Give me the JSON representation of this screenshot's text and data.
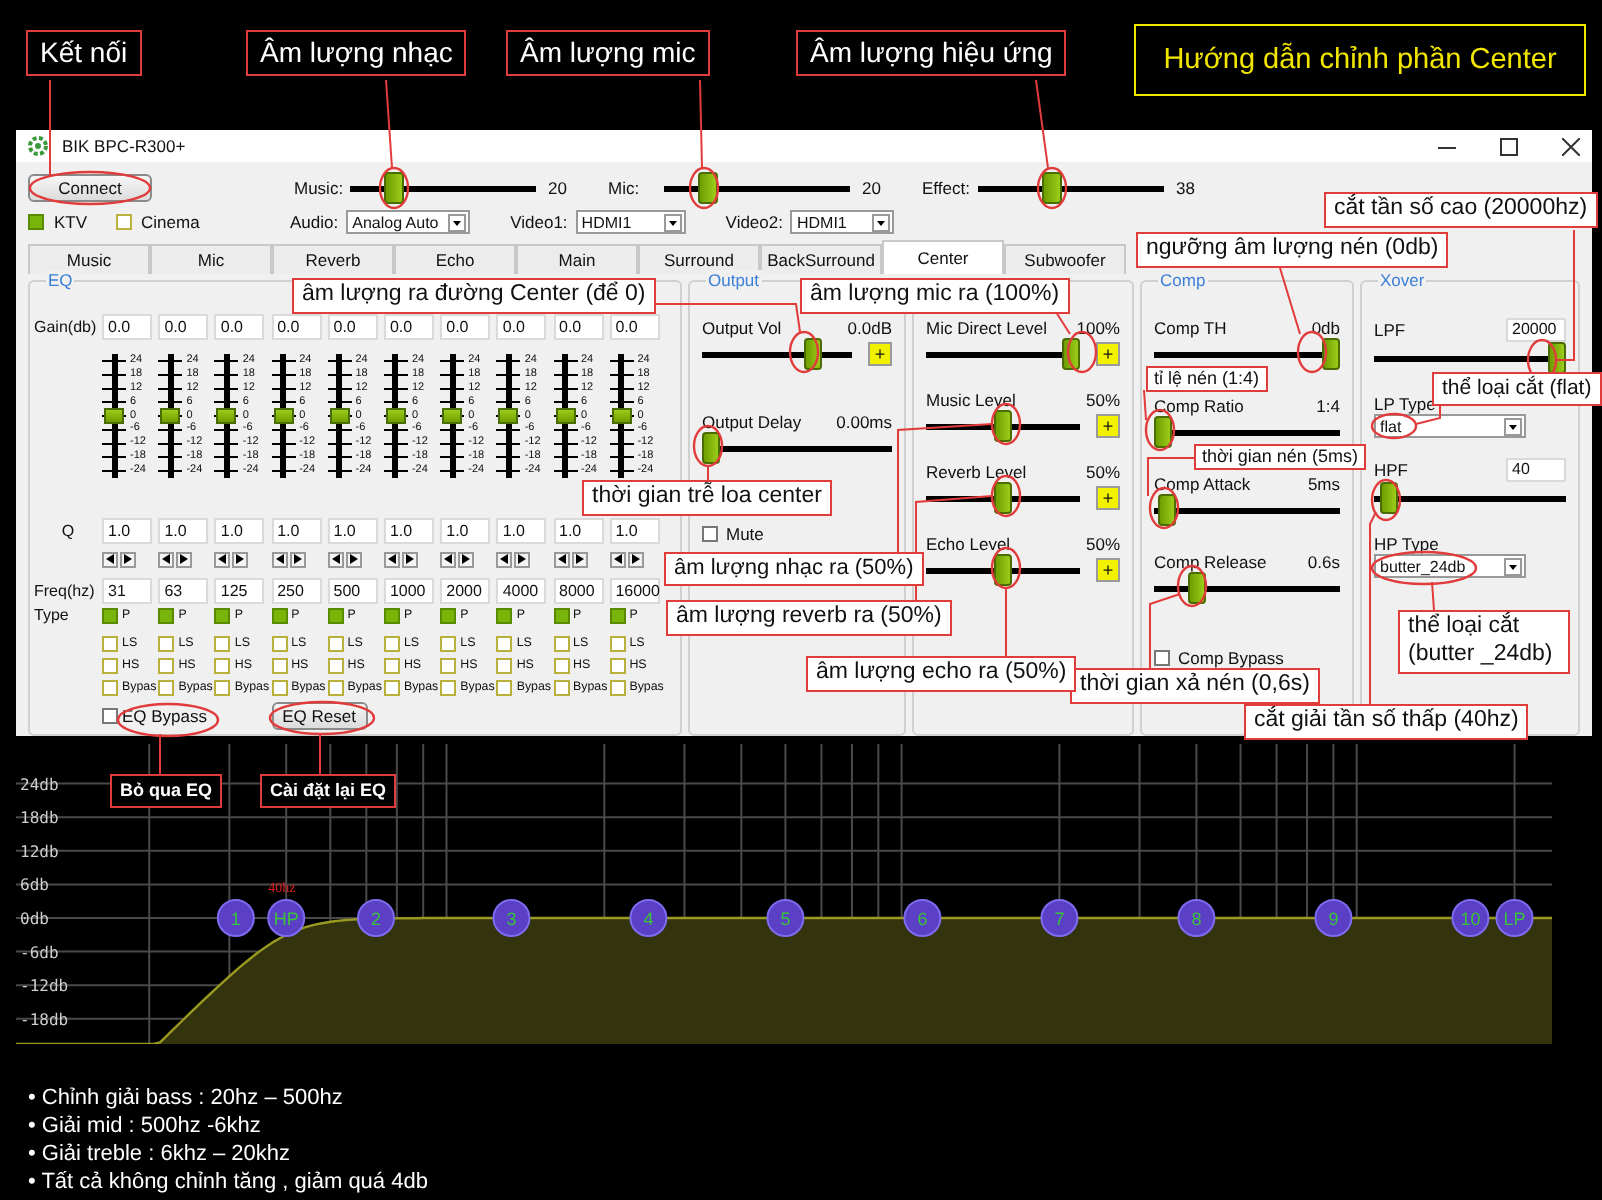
{
  "guide_title": "Hướng dẫn chỉnh phần Center",
  "window": {
    "title": "BIK BPC-R300+"
  },
  "connect_button": "Connect",
  "master_sliders": [
    {
      "label": "Music:",
      "level": 0.2,
      "reading": "20"
    },
    {
      "label": "Mic:",
      "level": 0.2,
      "reading": "20"
    },
    {
      "label": "Effect:",
      "level": 0.38,
      "reading": "38"
    }
  ],
  "mode_checks": [
    {
      "label": "KTV",
      "checked": true
    },
    {
      "label": "Cinema",
      "checked": false
    }
  ],
  "selects": [
    {
      "label": "Audio:",
      "value": "Analog Auto"
    },
    {
      "label": "Video1:",
      "value": "HDMI1"
    },
    {
      "label": "Video2:",
      "value": "HDMI1"
    }
  ],
  "tabs": [
    {
      "label": "Music",
      "selected": false
    },
    {
      "label": "Mic",
      "selected": false
    },
    {
      "label": "Reverb",
      "selected": false
    },
    {
      "label": "Echo",
      "selected": false
    },
    {
      "label": "Main",
      "selected": false
    },
    {
      "label": "Surround",
      "selected": false
    },
    {
      "label": "BackSurround",
      "selected": false
    },
    {
      "label": "Center",
      "selected": true
    },
    {
      "label": "Subwoofer",
      "selected": false
    }
  ],
  "eq": {
    "title": "EQ",
    "gain_label": "Gain(db)",
    "q_label": "Q",
    "freq_label": "Freq(hz)",
    "type_label": "Type",
    "bands": [
      {
        "gain": "0.0",
        "level": 0.5,
        "scale": [
          "24",
          "18",
          "12",
          "6",
          "0",
          "-6",
          "-12",
          "-18",
          "-24"
        ],
        "q": "1.0",
        "freq": "31",
        "types": [
          {
            "label": "P",
            "checked": true
          },
          {
            "label": "LS",
            "checked": false
          },
          {
            "label": "HS",
            "checked": false
          },
          {
            "label": "Bypas",
            "checked": false
          }
        ]
      },
      {
        "gain": "0.0",
        "level": 0.5,
        "scale": [
          "24",
          "18",
          "12",
          "6",
          "0",
          "-6",
          "-12",
          "-18",
          "-24"
        ],
        "q": "1.0",
        "freq": "63",
        "types": [
          {
            "label": "P",
            "checked": true
          },
          {
            "label": "LS",
            "checked": false
          },
          {
            "label": "HS",
            "checked": false
          },
          {
            "label": "Bypas",
            "checked": false
          }
        ]
      },
      {
        "gain": "0.0",
        "level": 0.5,
        "scale": [
          "24",
          "18",
          "12",
          "6",
          "0",
          "-6",
          "-12",
          "-18",
          "-24"
        ],
        "q": "1.0",
        "freq": "125",
        "types": [
          {
            "label": "P",
            "checked": true
          },
          {
            "label": "LS",
            "checked": false
          },
          {
            "label": "HS",
            "checked": false
          },
          {
            "label": "Bypas",
            "checked": false
          }
        ]
      },
      {
        "gain": "0.0",
        "level": 0.5,
        "scale": [
          "24",
          "18",
          "12",
          "6",
          "0",
          "-6",
          "-12",
          "-18",
          "-24"
        ],
        "q": "1.0",
        "freq": "250",
        "types": [
          {
            "label": "P",
            "checked": true
          },
          {
            "label": "LS",
            "checked": false
          },
          {
            "label": "HS",
            "checked": false
          },
          {
            "label": "Bypas",
            "checked": false
          }
        ]
      },
      {
        "gain": "0.0",
        "level": 0.5,
        "scale": [
          "24",
          "18",
          "12",
          "6",
          "0",
          "-6",
          "-12",
          "-18",
          "-24"
        ],
        "q": "1.0",
        "freq": "500",
        "types": [
          {
            "label": "P",
            "checked": true
          },
          {
            "label": "LS",
            "checked": false
          },
          {
            "label": "HS",
            "checked": false
          },
          {
            "label": "Bypas",
            "checked": false
          }
        ]
      },
      {
        "gain": "0.0",
        "level": 0.5,
        "scale": [
          "24",
          "18",
          "12",
          "6",
          "0",
          "-6",
          "-12",
          "-18",
          "-24"
        ],
        "q": "1.0",
        "freq": "1000",
        "types": [
          {
            "label": "P",
            "checked": true
          },
          {
            "label": "LS",
            "checked": false
          },
          {
            "label": "HS",
            "checked": false
          },
          {
            "label": "Bypas",
            "checked": false
          }
        ]
      },
      {
        "gain": "0.0",
        "level": 0.5,
        "scale": [
          "24",
          "18",
          "12",
          "6",
          "0",
          "-6",
          "-12",
          "-18",
          "-24"
        ],
        "q": "1.0",
        "freq": "2000",
        "types": [
          {
            "label": "P",
            "checked": true
          },
          {
            "label": "LS",
            "checked": false
          },
          {
            "label": "HS",
            "checked": false
          },
          {
            "label": "Bypas",
            "checked": false
          }
        ]
      },
      {
        "gain": "0.0",
        "level": 0.5,
        "scale": [
          "24",
          "18",
          "12",
          "6",
          "0",
          "-6",
          "-12",
          "-18",
          "-24"
        ],
        "q": "1.0",
        "freq": "4000",
        "types": [
          {
            "label": "P",
            "checked": true
          },
          {
            "label": "LS",
            "checked": false
          },
          {
            "label": "HS",
            "checked": false
          },
          {
            "label": "Bypas",
            "checked": false
          }
        ]
      },
      {
        "gain": "0.0",
        "level": 0.5,
        "scale": [
          "24",
          "18",
          "12",
          "6",
          "0",
          "-6",
          "-12",
          "-18",
          "-24"
        ],
        "q": "1.0",
        "freq": "8000",
        "types": [
          {
            "label": "P",
            "checked": true
          },
          {
            "label": "LS",
            "checked": false
          },
          {
            "label": "HS",
            "checked": false
          },
          {
            "label": "Bypas",
            "checked": false
          }
        ]
      },
      {
        "gain": "0.0",
        "level": 0.5,
        "scale": [
          "24",
          "18",
          "12",
          "6",
          "0",
          "-6",
          "-12",
          "-18",
          "-24"
        ],
        "q": "1.0",
        "freq": "16000",
        "types": [
          {
            "label": "P",
            "checked": true
          },
          {
            "label": "LS",
            "checked": false
          },
          {
            "label": "HS",
            "checked": false
          },
          {
            "label": "Bypas",
            "checked": false
          }
        ]
      }
    ],
    "bypass": {
      "label": "EQ Bypass",
      "checked": false
    },
    "reset_button": "EQ Reset"
  },
  "output": {
    "title": "Output",
    "items": [
      {
        "kind": "slider",
        "label": "Output Vol",
        "reading": "0.0dB",
        "level": 0.78,
        "plus": "+"
      },
      {
        "kind": "slider",
        "label": "Output Delay",
        "reading": "0.00ms",
        "level": 0
      },
      {
        "kind": "checkbox",
        "label": "Mute",
        "checked": false
      }
    ]
  },
  "mix": {
    "items": [
      {
        "kind": "slider",
        "label": "Mic Direct Level",
        "reading": "100%",
        "level": 1,
        "plus": "+"
      },
      {
        "kind": "slider",
        "label": "Music Level",
        "reading": "50%",
        "level": 0.5,
        "plus": "+"
      },
      {
        "kind": "slider",
        "label": "Reverb Level",
        "reading": "50%",
        "level": 0.5,
        "plus": "+"
      },
      {
        "kind": "slider",
        "label": "Echo Level",
        "reading": "50%",
        "level": 0.5,
        "plus": "+"
      }
    ]
  },
  "comp": {
    "title": "Comp",
    "items": [
      {
        "kind": "slider",
        "label": "Comp TH",
        "reading": "0db",
        "level": 1
      },
      {
        "kind": "slider",
        "label": "Comp Ratio",
        "reading": "1:4",
        "level": 0
      },
      {
        "kind": "slider",
        "label": "Comp Attack",
        "reading": "5ms",
        "level": 0.02
      },
      {
        "kind": "slider",
        "label": "Comp Release",
        "reading": "0.6s",
        "level": 0.2
      },
      {
        "kind": "checkbox",
        "label": "Comp Bypass",
        "checked": false
      }
    ]
  },
  "xover": {
    "title": "Xover",
    "items": [
      {
        "kind": "slider",
        "label": "LPF",
        "field": "20000",
        "level": 1
      },
      {
        "kind": "select",
        "label": "LP Type",
        "value": "flat"
      },
      {
        "kind": "slider",
        "label": "HPF",
        "field": "40",
        "level": 0.03
      },
      {
        "kind": "select",
        "label": "HP Type",
        "value": "butter_24db"
      }
    ]
  },
  "graph": {
    "y_labels": [
      "24db",
      "18db",
      "12db",
      "6db",
      "0db",
      "-6db",
      "-12db",
      "-18db"
    ],
    "marker_label": "40hz",
    "nodes": [
      {
        "label": "1",
        "kind": "band"
      },
      {
        "label": "HP",
        "kind": "hp"
      },
      {
        "label": "2",
        "kind": "band"
      },
      {
        "label": "3",
        "kind": "band"
      },
      {
        "label": "4",
        "kind": "band"
      },
      {
        "label": "5",
        "kind": "band"
      },
      {
        "label": "6",
        "kind": "band"
      },
      {
        "label": "7",
        "kind": "band"
      },
      {
        "label": "8",
        "kind": "band"
      },
      {
        "label": "9",
        "kind": "band"
      },
      {
        "label": "10",
        "kind": "band"
      },
      {
        "label": "LP",
        "kind": "lp"
      }
    ]
  },
  "annotations": [
    {
      "kind": "heading",
      "text": "Kết nối"
    },
    {
      "kind": "heading",
      "text": "Âm lượng nhạc"
    },
    {
      "kind": "heading",
      "text": "Âm lượng mic"
    },
    {
      "kind": "heading",
      "text": "Âm lượng hiệu ứng"
    },
    {
      "kind": "note",
      "text": "cắt tần số cao (20000hz)"
    },
    {
      "kind": "note",
      "text": "ngưỡng âm lượng nén (0db)"
    },
    {
      "kind": "note",
      "text": "âm lượng ra đường Center (để 0)"
    },
    {
      "kind": "note",
      "text": "âm lượng mic ra (100%)"
    },
    {
      "kind": "small",
      "text": "tỉ lệ nén (1:4)"
    },
    {
      "kind": "note",
      "text": "thể loại cắt (flat)"
    },
    {
      "kind": "small",
      "text": "thời gian nén (5ms)"
    },
    {
      "kind": "note",
      "text": "thời gian trễ loa center"
    },
    {
      "kind": "note",
      "text": "âm lượng nhạc ra (50%)"
    },
    {
      "kind": "note",
      "text": "âm lượng reverb ra (50%)"
    },
    {
      "kind": "note",
      "text": "thời gian xả nén (0,6s)"
    },
    {
      "kind": "note",
      "text": "thể loại cắt (butter _24db)"
    },
    {
      "kind": "note",
      "text": "âm lượng echo ra (50%)"
    },
    {
      "kind": "note",
      "text": "cắt giải tần số thấp (40hz)"
    },
    {
      "kind": "tag",
      "text": "Bỏ qua EQ"
    },
    {
      "kind": "tag",
      "text": "Cài đặt lại EQ"
    }
  ],
  "notes": [
    "• Chỉnh giải bass : 20hz – 500hz",
    "• Giải mid : 500hz -6khz",
    "• Giải treble : 6khz – 20khz",
    "• Tất cả không chỉnh tăng , giảm quá 4db"
  ]
}
